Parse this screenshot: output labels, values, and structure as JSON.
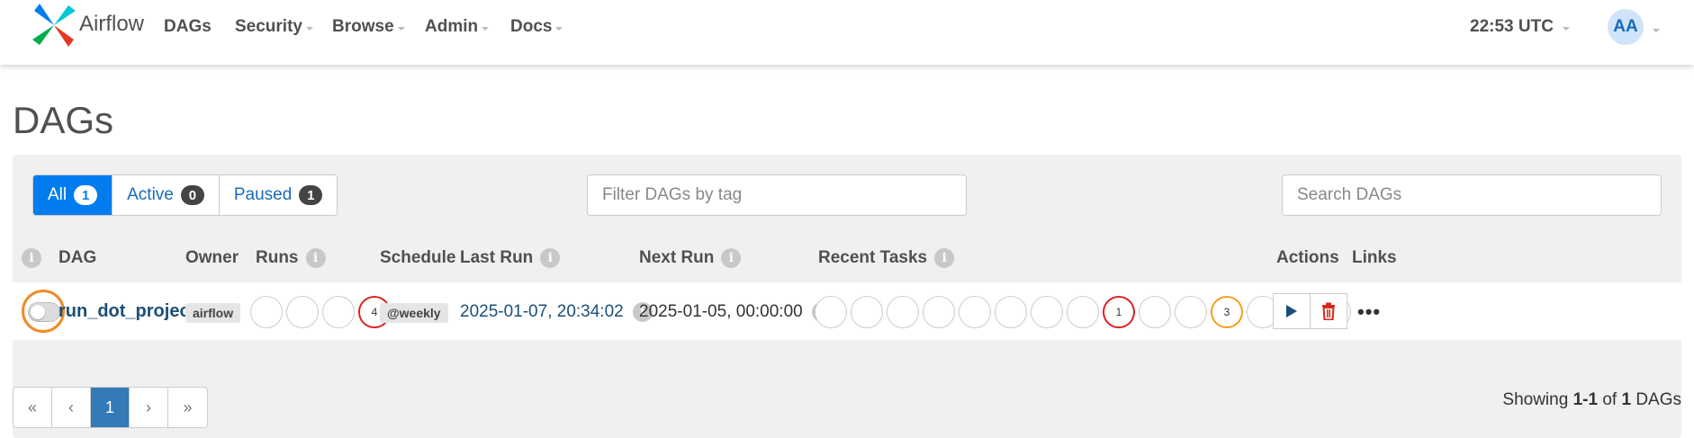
{
  "navbar": {
    "brand": "Airflow",
    "items": [
      "DAGs",
      "Security",
      "Browse",
      "Admin",
      "Docs"
    ],
    "time": "22:53 UTC",
    "avatar": "AA"
  },
  "page_title": "DAGs",
  "filters": {
    "all_label": "All",
    "all_count": "1",
    "active_label": "Active",
    "active_count": "0",
    "paused_label": "Paused",
    "paused_count": "1",
    "tag_placeholder": "Filter DAGs by tag",
    "search_placeholder": "Search DAGs"
  },
  "table": {
    "headers": {
      "dag": "DAG",
      "owner": "Owner",
      "runs": "Runs",
      "schedule": "Schedule",
      "last_run": "Last Run",
      "next_run": "Next Run",
      "recent_tasks": "Recent Tasks",
      "actions": "Actions",
      "links": "Links"
    },
    "row": {
      "dag_id": "run_dot_project",
      "owner": "airflow",
      "runs_failed": "4",
      "schedule": "@weekly",
      "last_run": "2025-01-07, 20:34:02",
      "next_run": "2025-01-05, 00:00:00",
      "tasks_failed": "1",
      "tasks_upstream_failed": "3",
      "links_more": "•••"
    }
  },
  "pagination": {
    "first": "«",
    "prev": "‹",
    "current": "1",
    "next": "›",
    "last": "»",
    "showing_prefix": "Showing",
    "range": "1-1",
    "of": "of",
    "total": "1",
    "suffix": "DAGs"
  },
  "colors": {
    "primary": "#017cee",
    "failed": "#e02020",
    "upstream_failed": "#f0a020",
    "highlight": "#f08a24"
  }
}
